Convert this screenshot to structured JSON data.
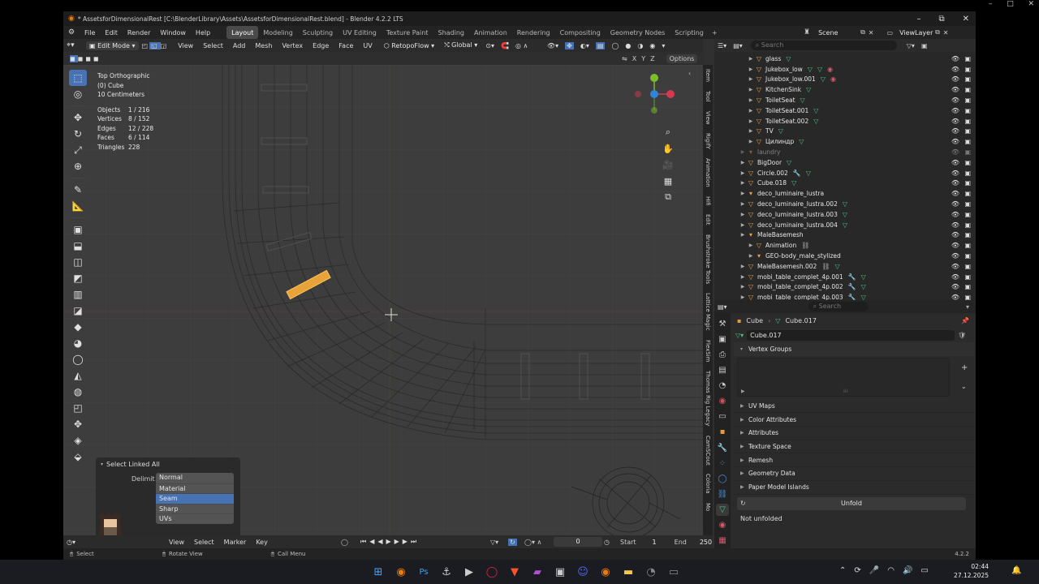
{
  "window": {
    "title": "* AssetsforDimensionalRest [C:\\BlenderLibrary\\Assets\\AssetsforDimensionalRest.blend] - Blender 4.2.2 LTS"
  },
  "menu": [
    "File",
    "Edit",
    "Render",
    "Window",
    "Help"
  ],
  "workspaces": [
    {
      "label": "Layout",
      "active": true
    },
    {
      "label": "Modeling"
    },
    {
      "label": "Sculpting"
    },
    {
      "label": "UV Editing"
    },
    {
      "label": "Texture Paint"
    },
    {
      "label": "Shading"
    },
    {
      "label": "Animation"
    },
    {
      "label": "Rendering"
    },
    {
      "label": "Compositing"
    },
    {
      "label": "Geometry Nodes"
    },
    {
      "label": "Scripting"
    }
  ],
  "add_workspace": "+",
  "scene": {
    "label": "Scene",
    "viewlayer": "ViewLayer"
  },
  "header3d": {
    "mode": "Edit Mode",
    "menus": [
      "View",
      "Select",
      "Add",
      "Mesh",
      "Vertex",
      "Edge",
      "Face",
      "UV"
    ],
    "retopoflow": "RetopoFlow",
    "orientation": "Global",
    "options": "Options",
    "axes": [
      "X",
      "Y",
      "Z"
    ]
  },
  "viewport_info": {
    "view": "Top Orthographic",
    "object": "(0) Cube",
    "scale": "10 Centimeters",
    "stats": [
      {
        "label": "Objects",
        "value": "1 / 216"
      },
      {
        "label": "Vertices",
        "value": "8 / 152"
      },
      {
        "label": "Edges",
        "value": "12 / 228"
      },
      {
        "label": "Faces",
        "value": "6 / 114"
      },
      {
        "label": "Triangles",
        "value": "228"
      }
    ]
  },
  "gizmo": {
    "x_color": "#d33a4e",
    "y_color": "#7cbd2c",
    "z_color": "#2f83d8"
  },
  "ntabs": [
    "Item",
    "Tool",
    "View",
    "RigifY",
    "Animation",
    "Hifi",
    "Edit",
    "Brushstroke Tools",
    "Lattice Magic",
    "FlexSim",
    "Thomas Rig Legacy",
    "CamSCout",
    "Coloria",
    "Mo"
  ],
  "redo_panel": {
    "title": "Select Linked All",
    "delimit_label": "Delimit",
    "options": [
      {
        "label": "Normal",
        "selected": false
      },
      {
        "label": "Material",
        "selected": false
      },
      {
        "label": "Seam",
        "selected": true
      },
      {
        "label": "Sharp",
        "selected": false
      },
      {
        "label": "UVs",
        "selected": false
      }
    ]
  },
  "timeline": {
    "menus": [
      "View",
      "Select",
      "Marker",
      "Key"
    ],
    "frame": "0",
    "start_label": "Start",
    "start": "1",
    "end_label": "End",
    "end": "250"
  },
  "statusbar": {
    "select": "Select",
    "rotate": "Rotate View",
    "call_menu": "Call Menu",
    "version": "4.2.2"
  },
  "outliner": {
    "search_placeholder": "Search",
    "items": [
      {
        "name": "glass",
        "indent": 2,
        "mods": [
          "mesh"
        ]
      },
      {
        "name": "Jukebox_low",
        "indent": 2,
        "mods": [
          "mesh",
          "mesh",
          "mat"
        ]
      },
      {
        "name": "Jukebox_low.001",
        "indent": 2,
        "mods": [
          "mesh",
          "mat"
        ]
      },
      {
        "name": "KitchenSink",
        "indent": 2,
        "mods": [
          "mesh"
        ]
      },
      {
        "name": "ToiletSeat",
        "indent": 2,
        "mods": [
          "mesh"
        ]
      },
      {
        "name": "ToiletSeat.001",
        "indent": 2,
        "mods": [
          "mesh"
        ]
      },
      {
        "name": "ToiletSeat.002",
        "indent": 2,
        "mods": [
          "mesh"
        ]
      },
      {
        "name": "TV",
        "indent": 2,
        "mods": [
          "mesh"
        ]
      },
      {
        "name": "Цилиндр",
        "indent": 2,
        "mods": [
          "mesh"
        ]
      },
      {
        "name": "laundry",
        "indent": 1,
        "mods": [],
        "dim": true
      },
      {
        "name": "BigDoor",
        "indent": 1,
        "mods": [
          "mesh"
        ]
      },
      {
        "name": "Circle.002",
        "indent": 1,
        "mods": [
          "wrench",
          "mesh"
        ]
      },
      {
        "name": "Cube.018",
        "indent": 1,
        "mods": [
          "mesh"
        ]
      },
      {
        "name": "deco_luminaire_lustra",
        "indent": 1,
        "mods": []
      },
      {
        "name": "deco_luminaire_lustra.002",
        "indent": 1,
        "mods": [
          "mesh"
        ]
      },
      {
        "name": "deco_luminaire_lustra.003",
        "indent": 1,
        "mods": [
          "mesh"
        ]
      },
      {
        "name": "deco_luminaire_lustra.004",
        "indent": 1,
        "mods": [
          "mesh"
        ]
      },
      {
        "name": "MaleBasemesh",
        "indent": 1,
        "mods": []
      },
      {
        "name": "Animation",
        "indent": 2,
        "mods": [
          "link"
        ]
      },
      {
        "name": "GEO-body_male_stylized",
        "indent": 2,
        "mods": []
      },
      {
        "name": "MaleBasemesh.002",
        "indent": 1,
        "mods": [
          "link",
          "mesh"
        ]
      },
      {
        "name": "mobi_table_complet_4p.001",
        "indent": 1,
        "mods": [
          "wrench",
          "mesh"
        ]
      },
      {
        "name": "mobi_table_complet_4p.002",
        "indent": 1,
        "mods": [
          "wrench",
          "mesh"
        ]
      },
      {
        "name": "mobi_table_complet_4p.003",
        "indent": 1,
        "mods": [
          "wrench",
          "mesh"
        ]
      }
    ]
  },
  "properties": {
    "search_placeholder": "Search",
    "breadcrumb_object": "Cube",
    "breadcrumb_mesh": "Cube.017",
    "mesh_name": "Cube.017",
    "panels_open": "Vertex Groups",
    "panels": [
      "UV Maps",
      "Color Attributes",
      "Attributes",
      "Texture Space",
      "Remesh",
      "Geometry Data",
      "Paper Model Islands"
    ],
    "unfold_button": "Unfold",
    "status": "Not unfolded"
  },
  "taskbar": {
    "time": "02:44",
    "date": "27.12.2025"
  }
}
